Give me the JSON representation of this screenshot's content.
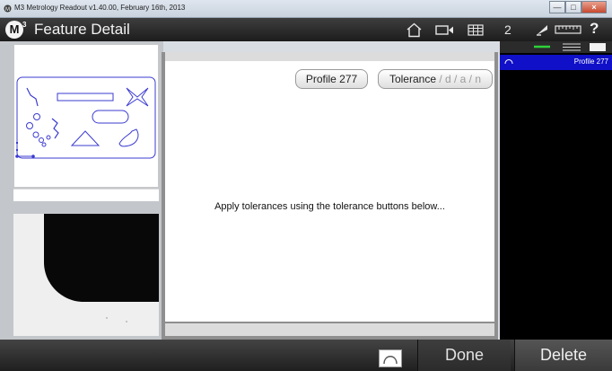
{
  "window": {
    "title": "M3 Metrology Readout  v1.40.00, February 16th, 2013",
    "buttons": [
      "—",
      "□",
      "×"
    ]
  },
  "header": {
    "title": "Feature Detail",
    "logo_text": "M",
    "logo_sup": "3",
    "icons": [
      "home-icon",
      "camera-icon",
      "grid-icon",
      "measure-icon",
      "ruler-icon"
    ],
    "count": "2",
    "help": "?"
  },
  "center": {
    "feature_button": "Profile 277",
    "tolerance_label": "Tolerance",
    "tolerance_sub": " / d / a / n",
    "message": "Apply tolerances using the tolerance buttons below..."
  },
  "feature_list": {
    "items": [
      {
        "label": "Profile 277",
        "icon": "arc-icon",
        "selected": true
      }
    ]
  },
  "bottom": {
    "arc_icon": "arc-icon",
    "done": "Done",
    "delete": "Delete"
  },
  "colors": {
    "selection": "#1010C8",
    "shape_stroke": "#3B3BD1",
    "header": "#2A2A2A"
  }
}
